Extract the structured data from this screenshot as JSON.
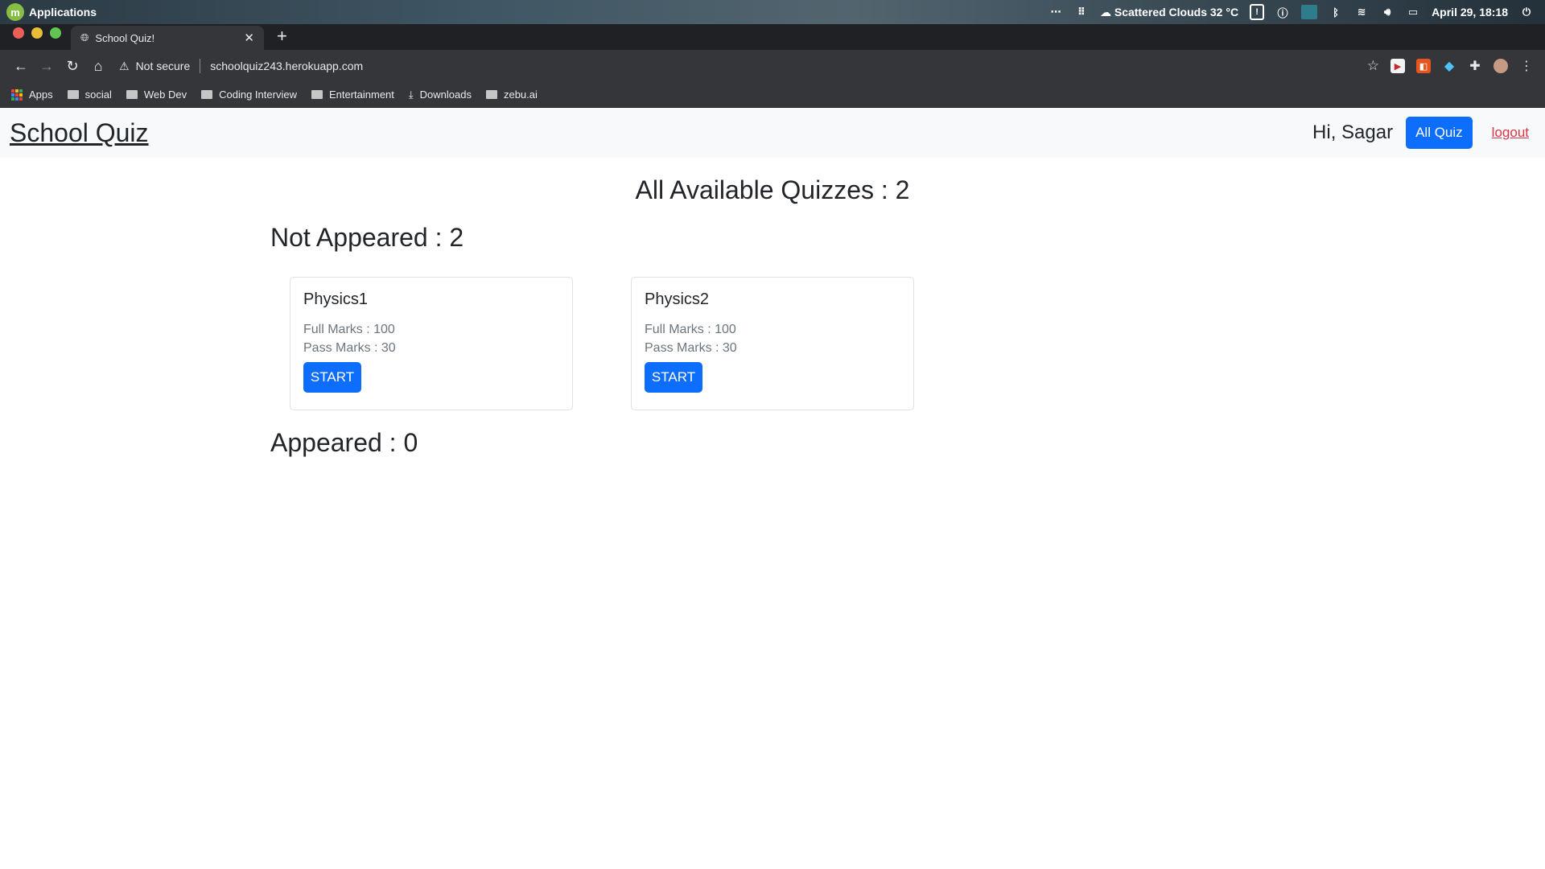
{
  "os_panel": {
    "apps_label": "Applications",
    "weather": "Scattered Clouds 32 °C",
    "datetime": "April 29, 18:18"
  },
  "browser": {
    "tab_title": "School Quiz!",
    "security_label": "Not secure",
    "url": "schoolquiz243.herokuapp.com",
    "bookmarks": [
      {
        "label": "Apps",
        "icon": "apps-grid-icon"
      },
      {
        "label": "social",
        "icon": "folder-icon"
      },
      {
        "label": "Web Dev",
        "icon": "folder-icon"
      },
      {
        "label": "Coding Interview",
        "icon": "folder-icon"
      },
      {
        "label": "Entertainment",
        "icon": "folder-icon"
      },
      {
        "label": "Downloads",
        "icon": "download-icon"
      },
      {
        "label": "zebu.ai",
        "icon": "folder-icon"
      }
    ]
  },
  "app": {
    "brand": "School Quiz",
    "greeting": "Hi, Sagar",
    "all_quiz_label": "All Quiz",
    "logout_label": "logout",
    "page_title": "All Available Quizzes : 2",
    "not_appeared_title": "Not Appeared : 2",
    "appeared_title": "Appeared : 0",
    "quizzes": [
      {
        "name": "Physics1",
        "full_marks": "Full Marks : 100",
        "pass_marks": "Pass Marks : 30",
        "start_label": "START"
      },
      {
        "name": "Physics2",
        "full_marks": "Full Marks : 100",
        "pass_marks": "Pass Marks : 30",
        "start_label": "START"
      }
    ]
  },
  "colors": {
    "primary": "#0d6efd",
    "danger": "#dc3545",
    "navbar_bg": "#f8f9fa"
  }
}
